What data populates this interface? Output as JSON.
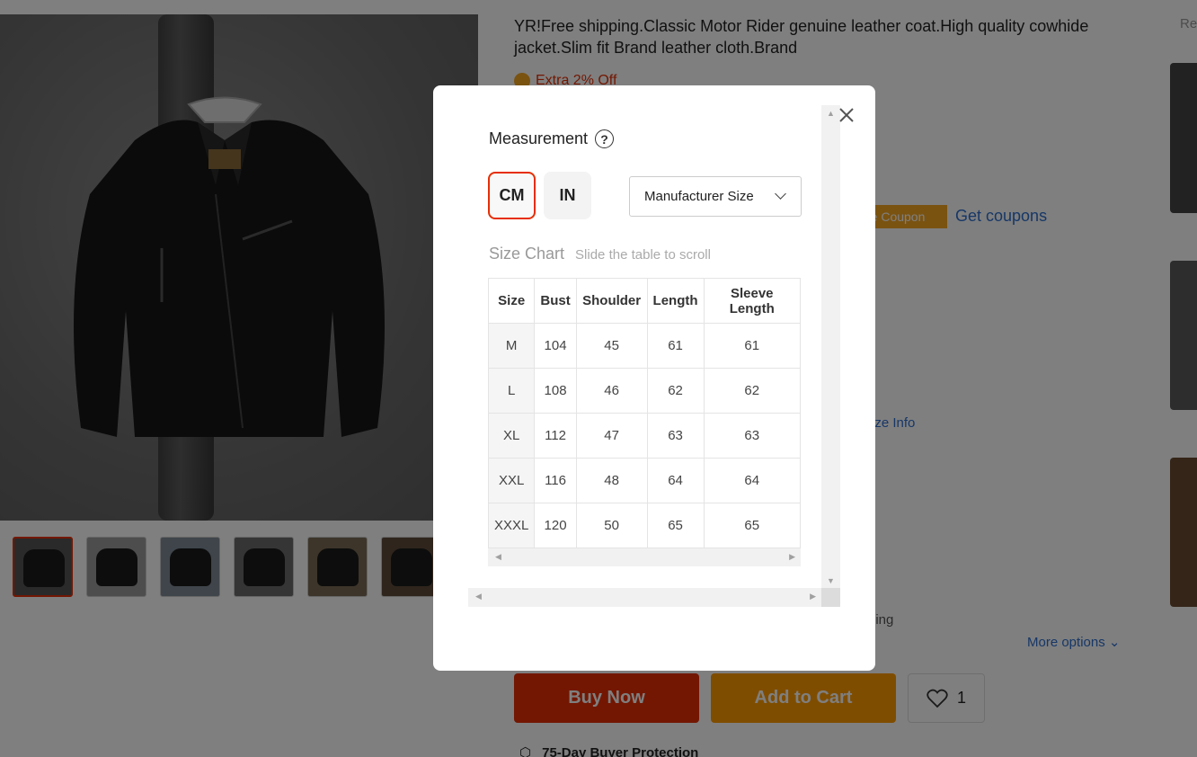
{
  "product": {
    "title": "YR!Free shipping.Classic Motor Rider genuine leather coat.High quality cowhide jacket.Slim fit Brand leather cloth.Brand",
    "extra_off": "Extra 2% Off",
    "store_coupon": "re Coupon",
    "get_coupons": "Get coupons",
    "size_info": "ize Info",
    "shipping": "ping",
    "more_options": "More options",
    "recommended_label": "Re",
    "buy_now": "Buy Now",
    "add_to_cart": "Add to Cart",
    "wishlist_count": "1",
    "protection": "75-Day Buyer Protection"
  },
  "colors": {
    "accent_red": "#e62e04",
    "accent_orange": "#ff9a00",
    "link_blue": "#2e6fcf"
  },
  "modal": {
    "title": "Measurement",
    "help_icon": "?",
    "units": [
      "CM",
      "IN"
    ],
    "selected_unit": "CM",
    "size_select": "Manufacturer Size",
    "size_chart_title": "Size Chart",
    "size_chart_hint": "Slide the table to scroll",
    "table": {
      "headers": [
        "Size",
        "Bust",
        "Shoulder",
        "Length",
        "Sleeve Length"
      ],
      "rows": [
        [
          "M",
          "104",
          "45",
          "61",
          "61"
        ],
        [
          "L",
          "108",
          "46",
          "62",
          "62"
        ],
        [
          "XL",
          "112",
          "47",
          "63",
          "63"
        ],
        [
          "XXL",
          "116",
          "48",
          "64",
          "64"
        ],
        [
          "XXXL",
          "120",
          "50",
          "65",
          "65"
        ]
      ]
    }
  }
}
